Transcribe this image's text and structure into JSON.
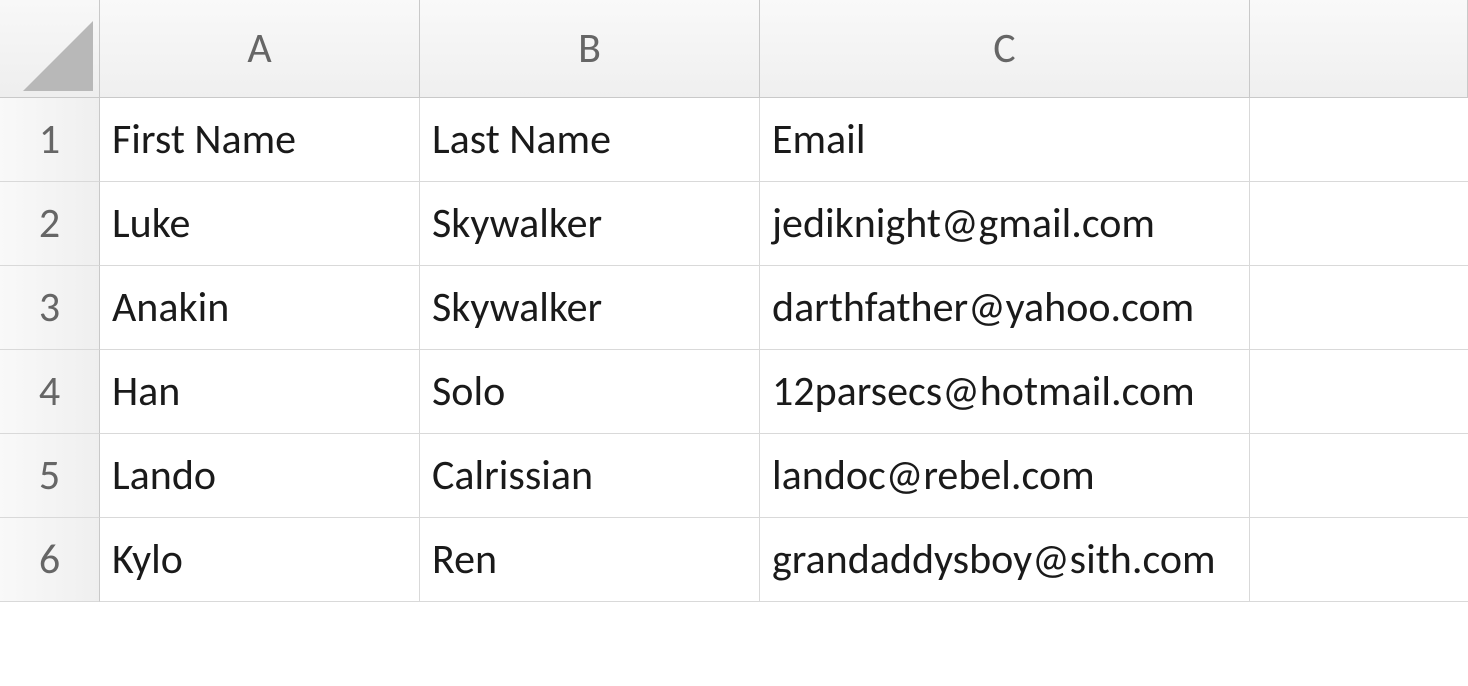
{
  "columns": [
    "A",
    "B",
    "C"
  ],
  "row_numbers": [
    "1",
    "2",
    "3",
    "4",
    "5",
    "6"
  ],
  "table": {
    "headers": [
      "First Name",
      "Last Name",
      "Email"
    ],
    "rows": [
      [
        "Luke",
        "Skywalker",
        "jediknight@gmail.com"
      ],
      [
        "Anakin",
        "Skywalker",
        "darthfather@yahoo.com"
      ],
      [
        "Han",
        "Solo",
        "12parsecs@hotmail.com"
      ],
      [
        "Lando",
        "Calrissian",
        "landoc@rebel.com"
      ],
      [
        "Kylo",
        "Ren",
        "grandaddysboy@sith.com"
      ]
    ]
  }
}
